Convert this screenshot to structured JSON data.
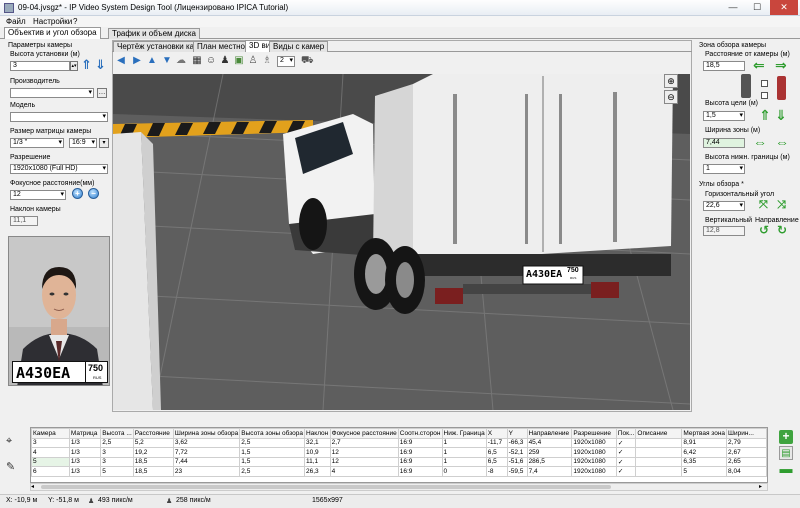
{
  "window": {
    "title": "09-04.jvsgz* - IP Video System Design Tool (Лицензировано IPICA Tutorial)"
  },
  "menu": [
    "Файл",
    "Настройки",
    "?"
  ],
  "top_tabs": [
    {
      "label": "Объектив и угол обзора",
      "active": true
    },
    {
      "label": "Трафик и объем диска",
      "active": false
    }
  ],
  "left": {
    "section_title": "Параметры камеры",
    "height_label": "Высота установки (м)",
    "height_value": "3",
    "manufacturer_label": "Производитель",
    "manufacturer_value": "",
    "model_label": "Модель",
    "model_value": "",
    "sensor_label": "Размер матрицы камеры",
    "sensor_value": "1/3 \"",
    "aspect_value": "16:9",
    "resolution_label": "Разрешение",
    "resolution_value": "1920x1080 (Full HD)",
    "focal_label": "Фокусное расстояние(мм)",
    "focal_value": "12",
    "tilt_label": "Наклон камеры",
    "tilt_value": "11,1",
    "plate_text": "А430ЕА",
    "plate_region": "750",
    "plate_country": "RUS"
  },
  "center": {
    "tabs": [
      {
        "label": "Чертёж установки камеры",
        "active": false
      },
      {
        "label": "План местности",
        "active": false
      },
      {
        "label": "3D вид",
        "active": true
      },
      {
        "label": "Виды с камер",
        "active": false
      }
    ],
    "toolbar_number": "2",
    "scene_plate_text": "А430ЕА",
    "scene_plate_region": "750",
    "plate_country": "RUS"
  },
  "right": {
    "zone_title": "Зона обзора камеры",
    "distance_label": "Расстояние от камеры (м)",
    "distance_value": "18,5",
    "target_height_label": "Высота цели (м)",
    "target_height_value": "1,5",
    "zone_width_label": "Ширина зоны (м)",
    "zone_width_value": "7,44",
    "lower_bound_label": "Высота нижн. границы (м)",
    "lower_bound_value": "1",
    "angles_title": "Углы обзора *",
    "horiz_label": "Горизонтальный угол",
    "horiz_value": "22,6",
    "vert_label": "Вертикальный",
    "vert_value": "12,8",
    "direction_label": "Направление"
  },
  "table": {
    "headers": [
      "Камера",
      "Матрица",
      "Высота ...",
      "Расстояние",
      "Ширина зоны обзора",
      "Высота зоны обзора",
      "Наклон",
      "Фокусное расстояние",
      "Соотн.сторон",
      "Ниж. Граница",
      "X",
      "Y",
      "Направление",
      "Разрешение",
      "Пок...",
      "Описание",
      "Мертвая зона",
      "Ширин..."
    ],
    "rows": [
      [
        "3",
        "1/3",
        "2,5",
        "5,2",
        "3,62",
        "2,5",
        "32,1",
        "2,7",
        "16:9",
        "1",
        "-11,7",
        "-66,3",
        "45,4",
        "1920x1080",
        "✓",
        "",
        "8,91",
        "2,79"
      ],
      [
        "4",
        "1/3",
        "3",
        "19,2",
        "7,72",
        "1,5",
        "10,9",
        "12",
        "16:9",
        "1",
        "6,5",
        "-52,1",
        "259",
        "1920x1080",
        "✓",
        "",
        "6,42",
        "2,67"
      ],
      [
        "5",
        "1/3",
        "3",
        "18,5",
        "7,44",
        "1,5",
        "11,1",
        "12",
        "16:9",
        "1",
        "6,5",
        "-51,6",
        "286,5",
        "1920x1080",
        "✓",
        "",
        "6,35",
        "2,65"
      ],
      [
        "6",
        "1/3",
        "5",
        "18,5",
        "23",
        "2,5",
        "26,3",
        "4",
        "16:9",
        "0",
        "-8",
        "-59,5",
        "7,4",
        "1920x1080",
        "✓",
        "",
        "5",
        "8,04"
      ]
    ],
    "selected_row": 2
  },
  "status": {
    "x": "X: -10,9 м",
    "y": "Y: -51,8 м",
    "ppm1": "493 пикс/м",
    "ppm2": "258 пикс/м",
    "size": "1565x997"
  }
}
